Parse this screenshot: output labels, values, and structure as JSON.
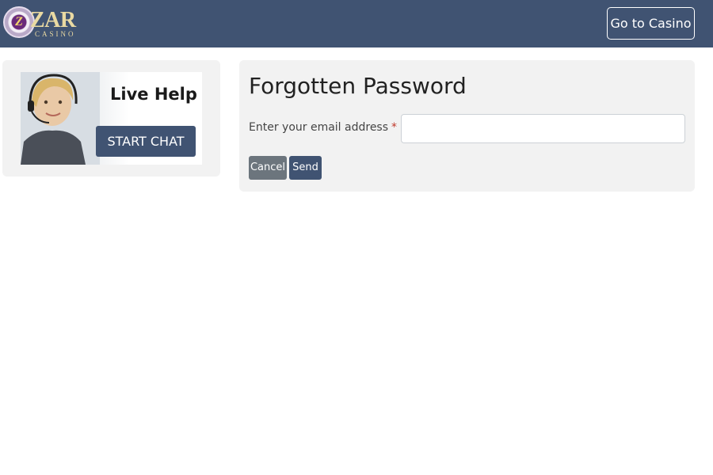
{
  "header": {
    "logo": {
      "chip_letter": "Z",
      "word": "ZAR",
      "sub": "CASINO"
    },
    "goto_casino_label": "Go to Casino"
  },
  "live_help": {
    "title": "Live Help",
    "chat_button_label": "START CHAT"
  },
  "form": {
    "title": "Forgotten Password",
    "email_label": "Enter your email address",
    "required_mark": "*",
    "email_value": "",
    "email_placeholder": "",
    "cancel_label": "Cancel",
    "send_label": "Send"
  },
  "colors": {
    "header_bg": "#405372",
    "panel_bg": "#f2f2f2",
    "cancel_bg": "#6c757d",
    "primary_bg": "#405372"
  }
}
